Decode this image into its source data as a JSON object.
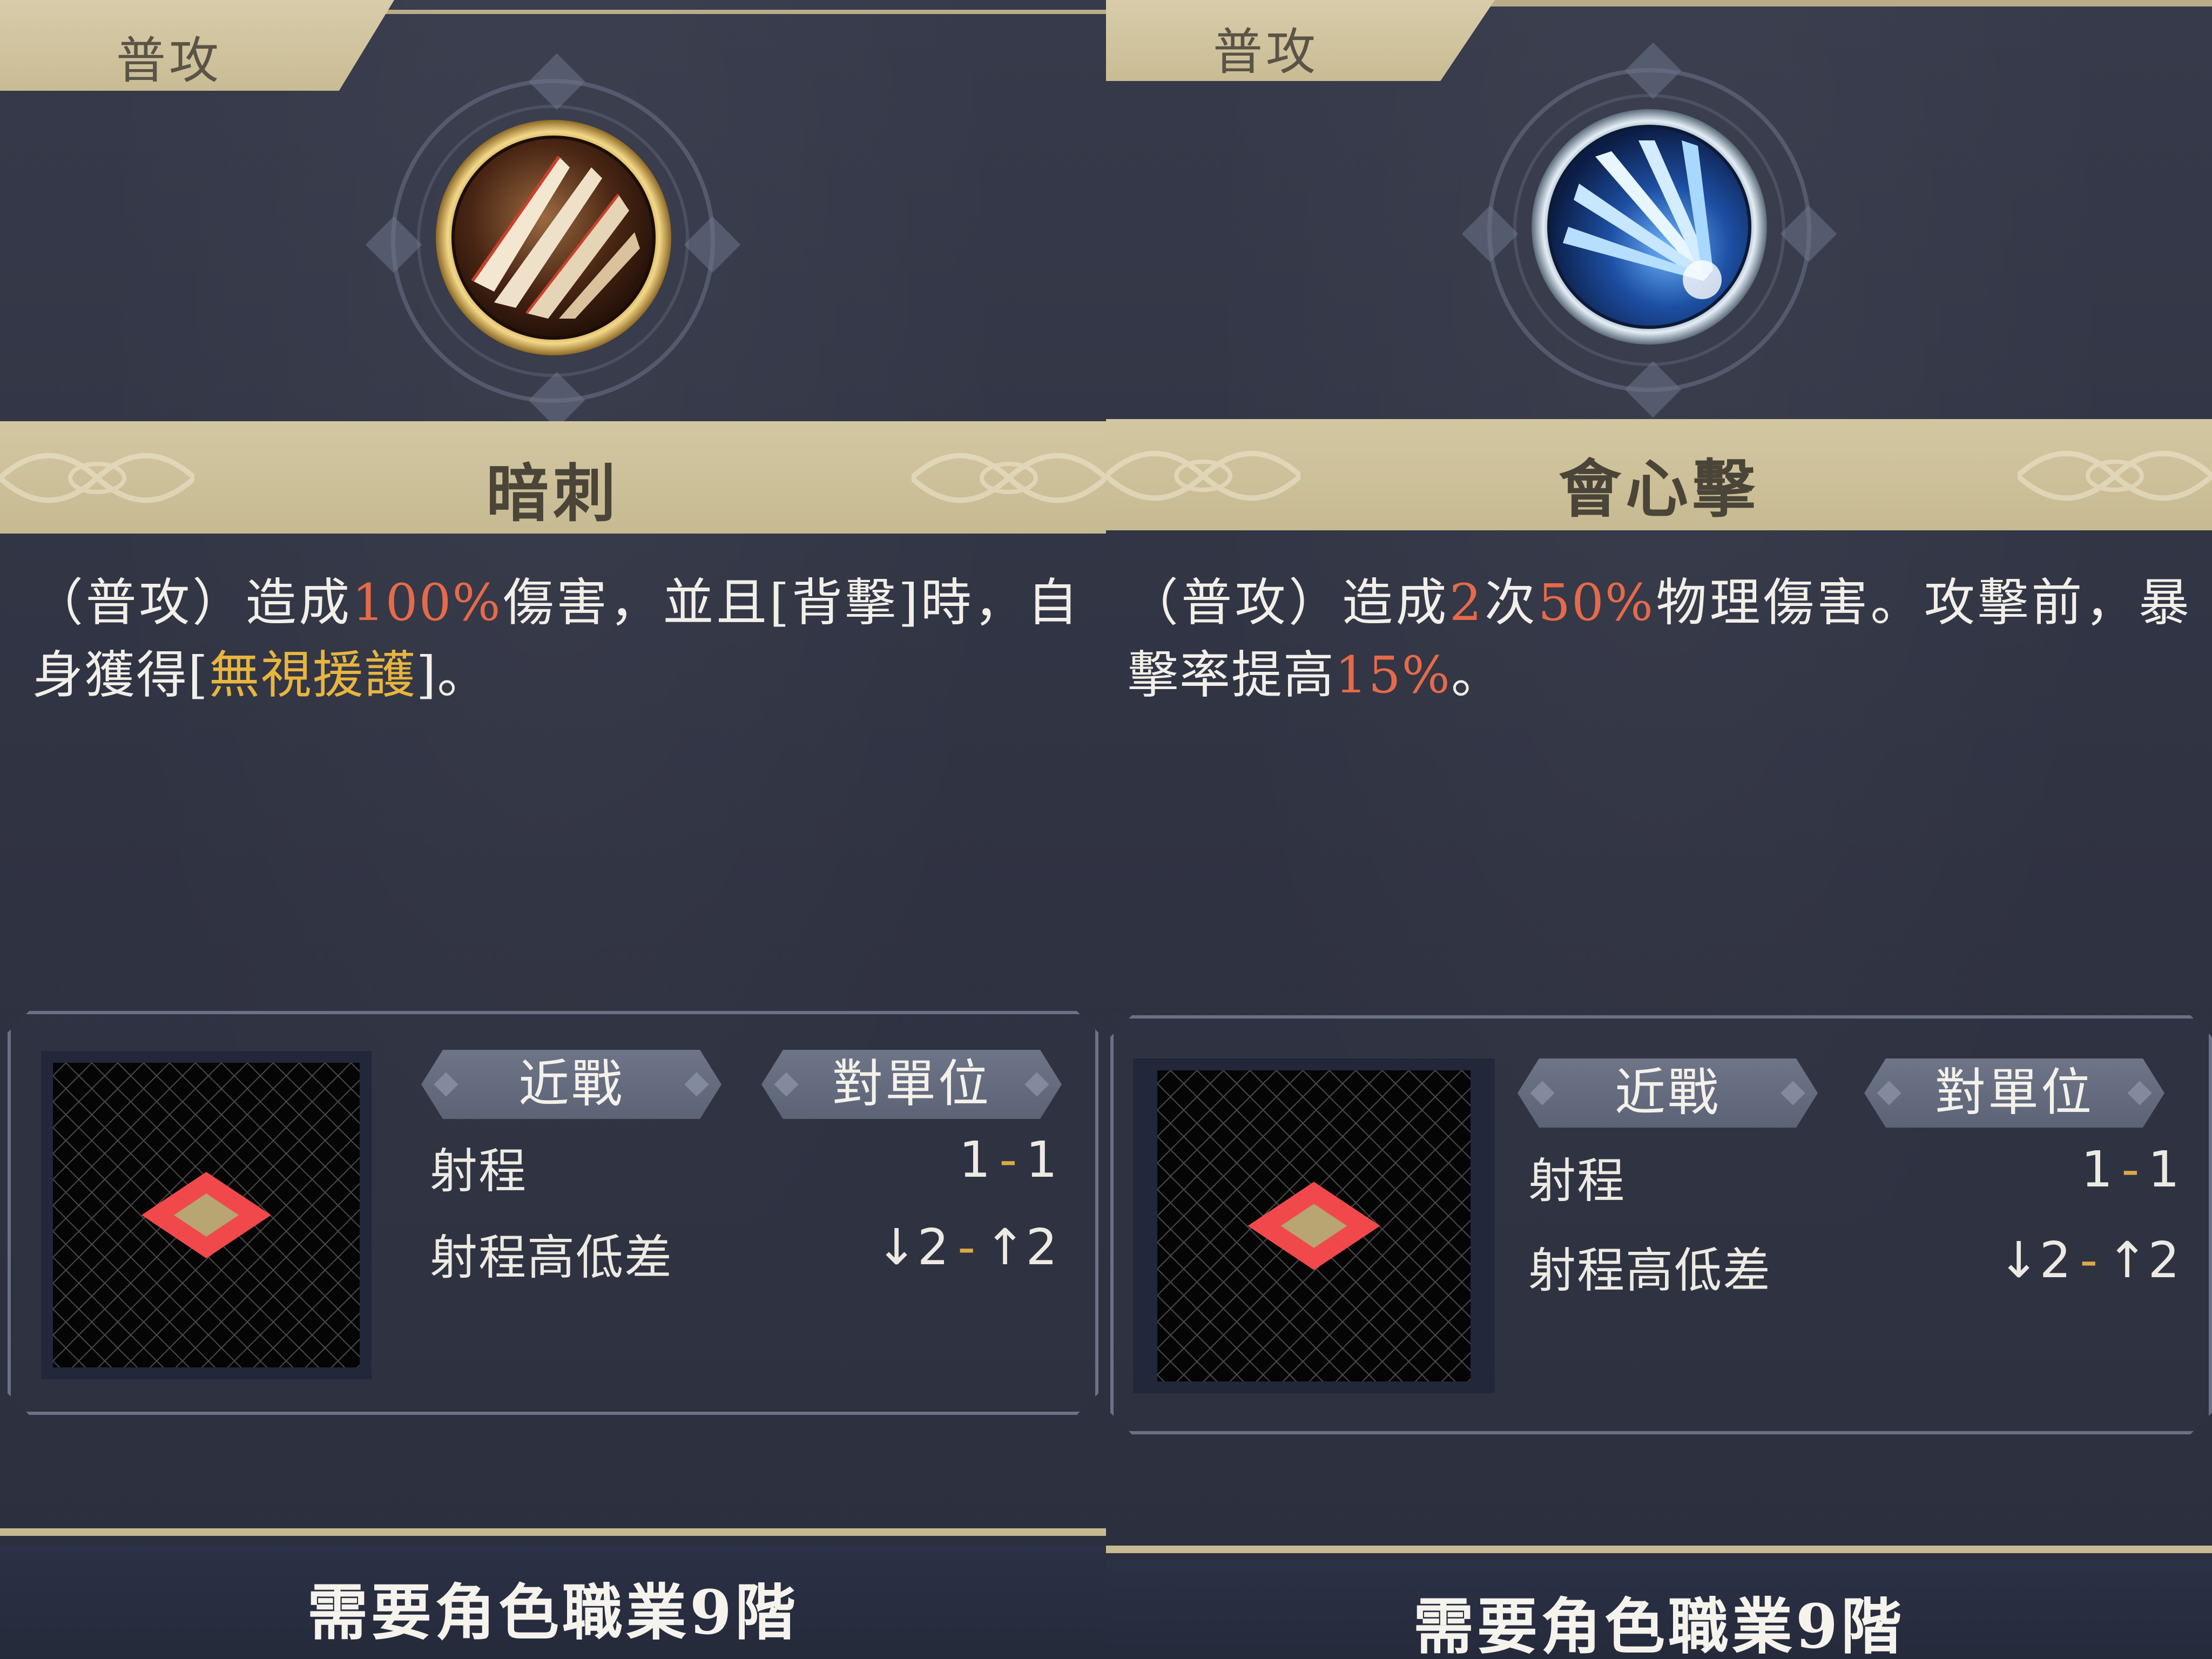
{
  "panels": [
    {
      "tab": "普攻",
      "icon": "dark-claw-icon",
      "name": "暗刺",
      "desc": {
        "p1": "（普攻）造成",
        "v1": "100%",
        "p2": "傷害，並且[背擊]時，自身獲得[",
        "v2": "無視援護",
        "p3": "]。"
      },
      "tags": [
        "近戰",
        "對單位"
      ],
      "stats": [
        {
          "label": "射程",
          "from": "1",
          "sep": "-",
          "to": "1"
        },
        {
          "label": "射程高低差",
          "from": "↓2",
          "sep": "-",
          "to": "↑2"
        }
      ],
      "requirement": "需要角色職業9階"
    },
    {
      "tab": "普攻",
      "icon": "ice-burst-icon",
      "name": "會心擊",
      "desc": {
        "p1": "（普攻）造成",
        "v1": "2",
        "p2": "次",
        "v2": "50%",
        "p3": "物理傷害。攻擊前，暴擊率提高",
        "v3": "15%",
        "p4": "。"
      },
      "tags": [
        "近戰",
        "對單位"
      ],
      "stats": [
        {
          "label": "射程",
          "from": "1",
          "sep": "-",
          "to": "1"
        },
        {
          "label": "射程高低差",
          "from": "↓2",
          "sep": "-",
          "to": "↑2"
        }
      ],
      "requirement": "需要角色職業9階"
    }
  ],
  "colors": {
    "highlight_red": "#e66a4a",
    "highlight_gold": "#e8b53e",
    "banner": "#d3c7a2",
    "panel_bg": "#33364a"
  }
}
